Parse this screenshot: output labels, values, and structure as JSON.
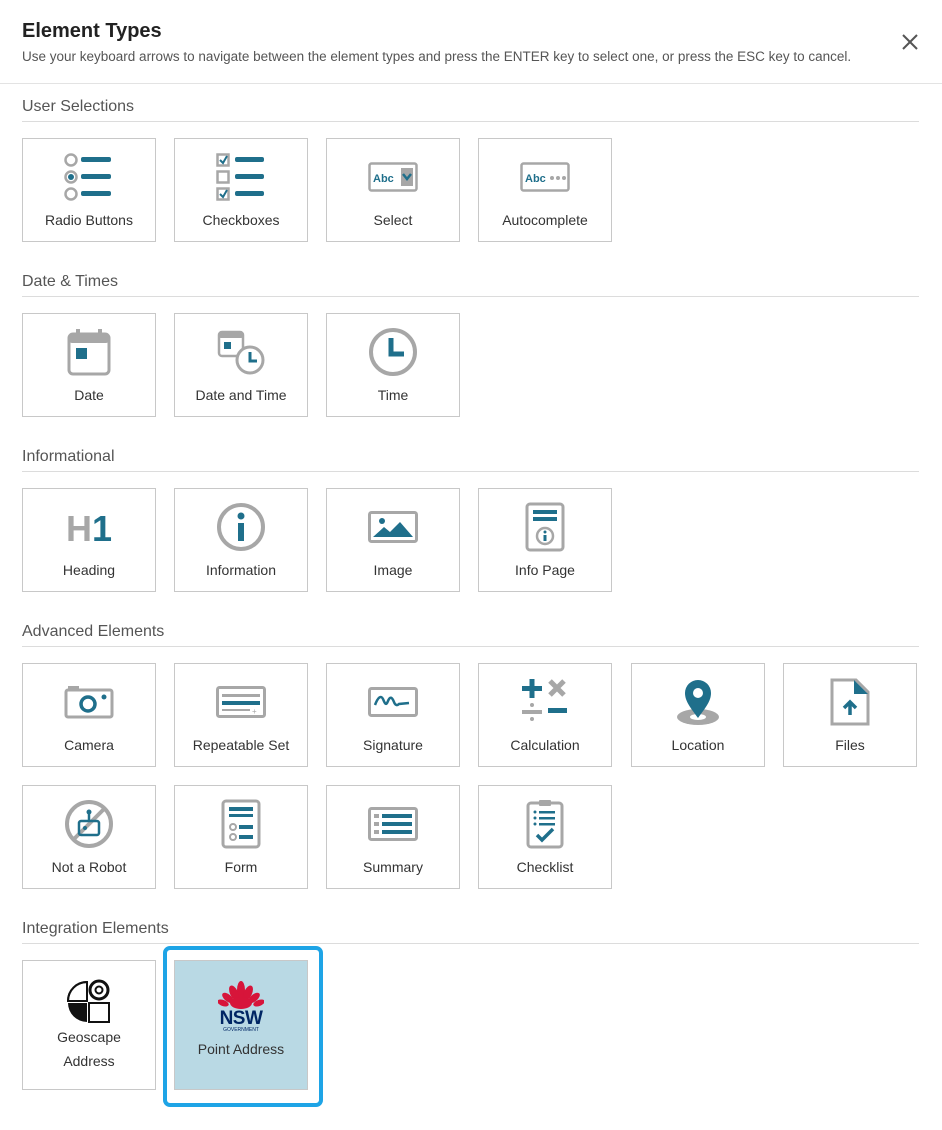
{
  "dialog": {
    "title": "Element Types",
    "subtitle": "Use your keyboard arrows to navigate between the element types and press the ENTER key to select one, or press the ESC key to cancel."
  },
  "colors": {
    "accent": "#1f6f8b",
    "icon_gray": "#a7a7a7",
    "selected_bg": "#b9d9e4",
    "focus_ring": "#1ea4e6",
    "nsw_red": "#d7153a",
    "nsw_blue": "#002664"
  },
  "sections": {
    "user_selections": {
      "title": "User Selections",
      "items": [
        {
          "label": "Radio Buttons",
          "icon": "radio-buttons-icon"
        },
        {
          "label": "Checkboxes",
          "icon": "checkboxes-icon"
        },
        {
          "label": "Select",
          "icon": "select-icon"
        },
        {
          "label": "Autocomplete",
          "icon": "autocomplete-icon"
        }
      ]
    },
    "date_times": {
      "title": "Date & Times",
      "items": [
        {
          "label": "Date",
          "icon": "calendar-icon"
        },
        {
          "label": "Date and Time",
          "icon": "date-time-icon"
        },
        {
          "label": "Time",
          "icon": "clock-icon"
        }
      ]
    },
    "informational": {
      "title": "Informational",
      "items": [
        {
          "label": "Heading",
          "icon": "heading-icon"
        },
        {
          "label": "Information",
          "icon": "info-icon"
        },
        {
          "label": "Image",
          "icon": "image-icon"
        },
        {
          "label": "Info Page",
          "icon": "info-page-icon"
        }
      ]
    },
    "advanced": {
      "title": "Advanced Elements",
      "items": [
        {
          "label": "Camera",
          "icon": "camera-icon"
        },
        {
          "label": "Repeatable Set",
          "icon": "repeatable-set-icon"
        },
        {
          "label": "Signature",
          "icon": "signature-icon"
        },
        {
          "label": "Calculation",
          "icon": "calculation-icon"
        },
        {
          "label": "Location",
          "icon": "location-pin-icon"
        },
        {
          "label": "Files",
          "icon": "file-upload-icon"
        },
        {
          "label": "Not a Robot",
          "icon": "not-a-robot-icon"
        },
        {
          "label": "Form",
          "icon": "form-icon"
        },
        {
          "label": "Summary",
          "icon": "summary-icon"
        },
        {
          "label": "Checklist",
          "icon": "checklist-icon"
        }
      ]
    },
    "integration": {
      "title": "Integration Elements",
      "items": [
        {
          "label_line1": "Geoscape",
          "label_line2": "Address",
          "icon": "geoscape-logo-icon"
        },
        {
          "label": "Point Address",
          "icon": "nsw-government-logo-icon",
          "logo_text": "NSW",
          "logo_subtext": "GOVERNMENT",
          "selected": true
        }
      ]
    }
  }
}
